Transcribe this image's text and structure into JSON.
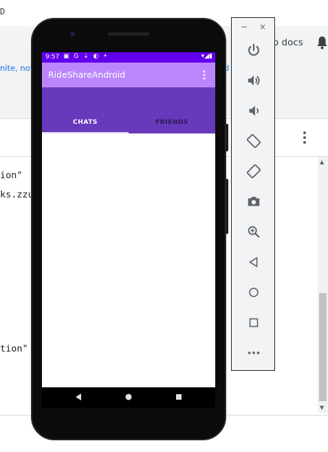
{
  "background": {
    "title_fragment": "D",
    "banner_left": "nite, nov",
    "banner_right": "d",
    "docs_link": "o docs",
    "code_lines": [
      {
        "text": "ion\""
      },
      {
        "text": "ks.zzu"
      },
      {
        "text": "tion\""
      }
    ]
  },
  "emulator_panel": {
    "minimize": "−",
    "close": "×",
    "buttons": [
      "power",
      "volume-up",
      "volume-down",
      "rotate-left",
      "rotate-right",
      "screenshot",
      "zoom",
      "back",
      "home",
      "overview",
      "more"
    ]
  },
  "phone": {
    "status": {
      "time": "9:57",
      "icons": "▣ G ⇣ ◐ •",
      "right": "▾◢▮"
    },
    "app_title": "RideShareAndroid",
    "tabs": [
      {
        "label": "CHATS",
        "selected": true
      },
      {
        "label": "FRIENDS",
        "selected": false
      }
    ],
    "colors": {
      "status_bar": "#6200ee",
      "app_bar": "#bb86fc",
      "tab_bar": "#6739bb"
    }
  }
}
